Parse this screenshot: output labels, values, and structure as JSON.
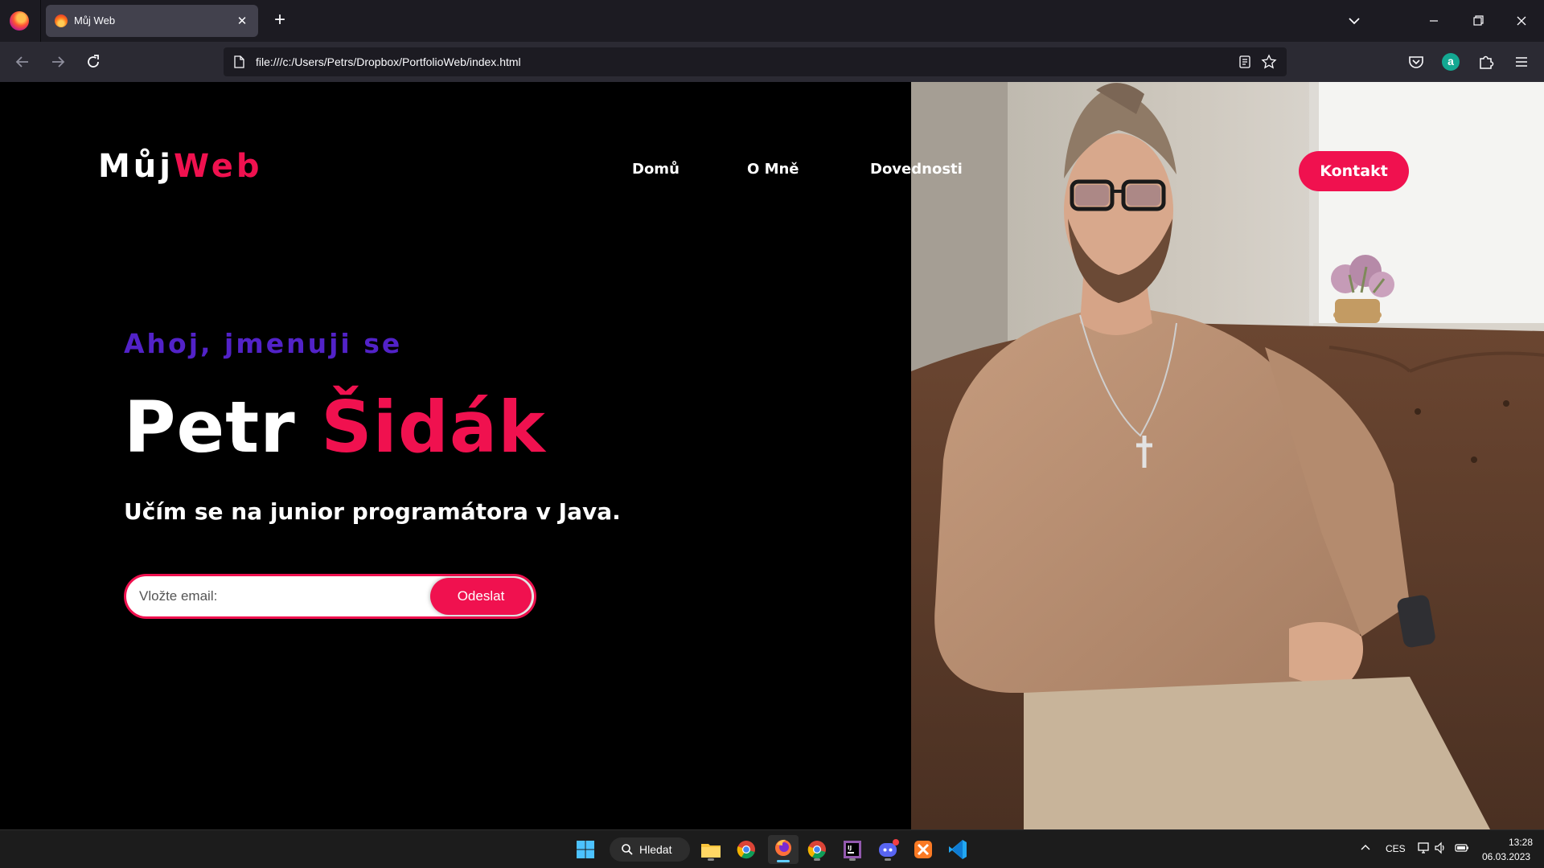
{
  "browser": {
    "tab_title": "Můj Web",
    "tab_close": "✕",
    "new_tab": "+",
    "url": "file:///c:/Users/Petrs/Dropbox/PortfolioWeb/index.html",
    "extension_letter": "a"
  },
  "site": {
    "logo_main": "Můj",
    "logo_accent": "Web",
    "nav": [
      {
        "label": "Domů"
      },
      {
        "label": "O Mně"
      },
      {
        "label": "Dovednosti"
      }
    ],
    "cta_label": "Kontakt",
    "greeting": "Ahoj, jmenuji se",
    "first_name": "Petr",
    "last_name": "Šidák",
    "tagline": "Učím se na junior programátora v Java.",
    "email_placeholder": "Vložte email:",
    "submit_label": "Odeslat",
    "colors": {
      "accent": "#f0114f",
      "greeting": "#5222c8",
      "background": "#000000"
    }
  },
  "taskbar": {
    "search_label": "Hledat",
    "language": "CES",
    "time": "13:28",
    "date": "06.03.2023",
    "apps": [
      "windows-start-icon",
      "file-explorer-icon",
      "chrome-icon",
      "firefox-icon",
      "chrome-profile-icon",
      "intellij-icon",
      "discord-icon",
      "xampp-icon",
      "vscode-icon"
    ]
  }
}
